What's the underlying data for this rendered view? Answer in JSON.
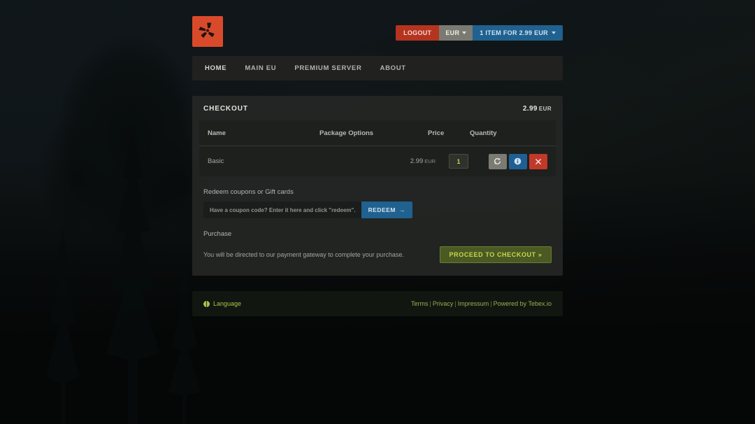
{
  "header": {
    "logo_alt": "server-logo",
    "logout_label": "LOGOUT",
    "currency_label": "EUR",
    "cart_label": "1 ITEM FOR 2.99 EUR"
  },
  "nav": {
    "items": [
      {
        "label": "HOME"
      },
      {
        "label": "MAIN EU"
      },
      {
        "label": "PREMIUM SERVER"
      },
      {
        "label": "ABOUT"
      }
    ]
  },
  "checkout": {
    "title": "CHECKOUT",
    "total_amount": "2.99",
    "total_currency": "EUR",
    "table": {
      "headers": {
        "name": "Name",
        "package_options": "Package Options",
        "price": "Price",
        "quantity": "Quantity"
      },
      "rows": [
        {
          "name": "Basic",
          "package_options": "",
          "price_amount": "2.99",
          "price_currency": "EUR",
          "quantity": "1",
          "actions": {
            "update": "refresh-icon",
            "info": "info-icon",
            "remove": "close-icon"
          }
        }
      ]
    }
  },
  "coupon": {
    "section_label": "Redeem coupons or Gift cards",
    "input_value": "",
    "input_placeholder": "Have a coupon code? Enter it here and click \"redeem\".",
    "redeem_label": "REDEEM",
    "redeem_arrow": "→"
  },
  "purchase": {
    "section_label": "Purchase",
    "note": "You will be directed to our payment gateway to complete your purchase.",
    "button_label": "PROCEED TO CHECKOUT »"
  },
  "footer": {
    "language_label": "Language",
    "links": [
      {
        "label": "Terms"
      },
      {
        "label": "Privacy"
      },
      {
        "label": "Impressum"
      },
      {
        "label": "Powered by Tebex.io"
      }
    ],
    "separator": "|"
  },
  "colors": {
    "brand_red": "#d94a2b",
    "logout_red": "#b5341f",
    "cart_blue": "#20618f",
    "currency_gray": "#7a7a72",
    "proceed_green": "#4b5a22",
    "proceed_text": "#c5d84e",
    "quantity_text": "#c9d24a",
    "footer_link": "#9aad52",
    "action_gray": "#7b7b74",
    "action_blue": "#1f6094",
    "action_red": "#c2392a"
  }
}
